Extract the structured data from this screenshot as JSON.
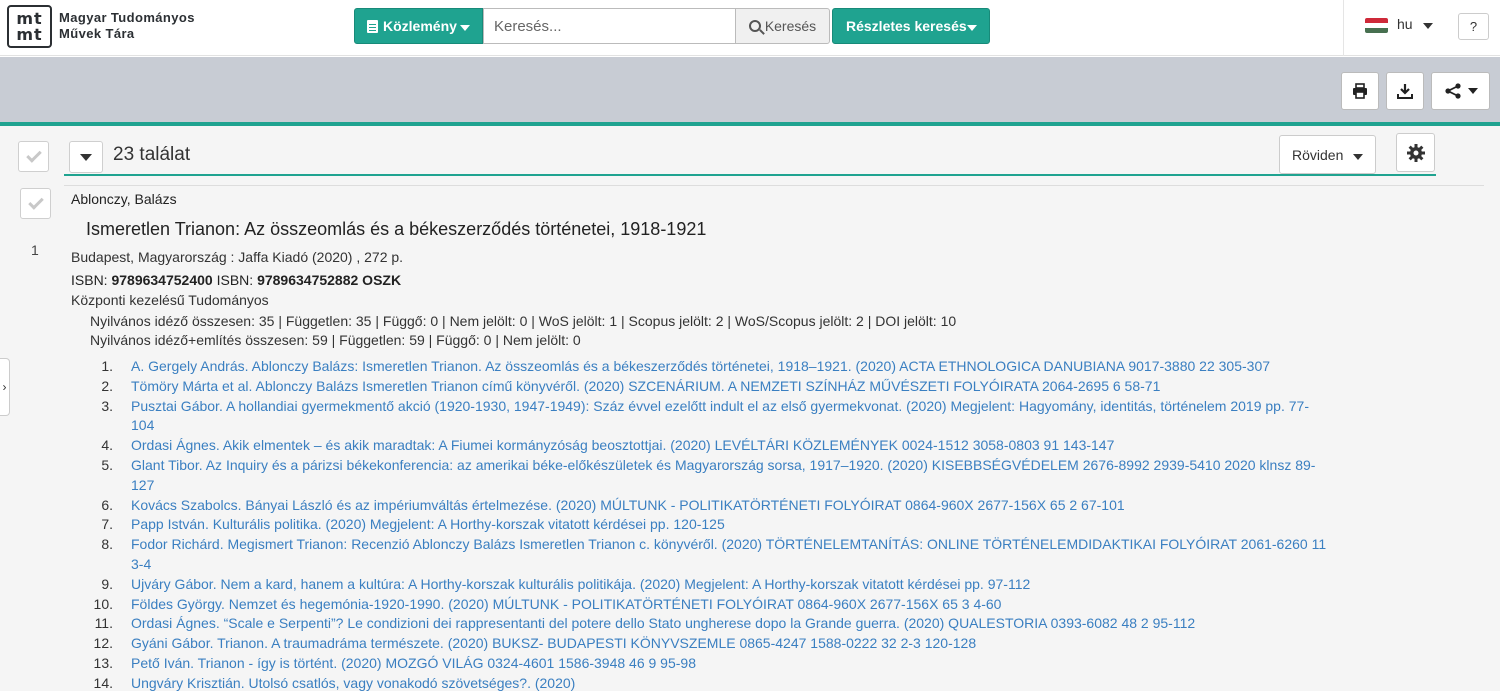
{
  "header": {
    "logo_line1": "mt",
    "logo_line2": "mt",
    "logo_text_line1": "Magyar Tudományos",
    "logo_text_line2": "Művek Tára",
    "publication_button": "Közlemény",
    "search_placeholder": "Keresés...",
    "search_button": "Keresés",
    "advanced_search_button": "Részletes keresés",
    "language": "hu",
    "help": "?"
  },
  "colors": {
    "accent": "#1fa390",
    "link": "#3a7fc1",
    "toolbar_bg": "#c8ccd4"
  },
  "toolbar": {
    "icons": [
      "print-icon",
      "download-icon",
      "share-icon"
    ]
  },
  "results": {
    "count_label": "23 találat",
    "sort_label": "Röviden"
  },
  "record": {
    "number": "1",
    "author": "Ablonczy, Balázs",
    "title": "Ismeretlen Trianon: Az összeomlás és a békeszerződés történetei, 1918-1921",
    "pub_info": "Budapest, Magyarország : Jaffa Kiadó (2020) , 272 p.",
    "isbn_label1": "ISBN: ",
    "isbn1": "9789634752400",
    "isbn_label2": " ISBN: ",
    "isbn2": "9789634752882",
    "oszk": " OSZK",
    "category": "Központi kezelésű Tudományos",
    "citation_stats": "Nyilvános idéző összesen: 35 | Független: 35 | Függő: 0 | Nem jelölt: 0 | WoS jelölt: 1 | Scopus jelölt: 2 | WoS/Scopus jelölt: 2 | DOI jelölt: 10",
    "mention_stats": "Nyilvános idéző+említés összesen: 59 | Független: 59 | Függő: 0 | Nem jelölt: 0"
  },
  "citations": [
    {
      "n": "1.",
      "text": "A. Gergely András. Ablonczy Balázs: Ismeretlen Trianon. Az összeomlás és a békeszerződés történetei, 1918–1921. (2020) ACTA ETHNOLOGICA DANUBIANA 9017-3880 22 305-307"
    },
    {
      "n": "2.",
      "text": "Tömöry Márta et al. Ablonczy Balázs Ismeretlen Trianon című könyvéről. (2020) SZCENÁRIUM. A NEMZETI SZÍNHÁZ MŰVÉSZETI FOLYÓIRATA 2064-2695 6 58-71"
    },
    {
      "n": "3.",
      "text": "Pusztai Gábor. A hollandiai gyermekmentő akció (1920-1930, 1947-1949): Száz évvel ezelőtt indult el az első gyermekvonat. (2020) Megjelent: Hagyomány, identitás, történelem 2019 pp. 77-104"
    },
    {
      "n": "4.",
      "text": "Ordasi Ágnes. Akik elmentek – és akik maradtak: A Fiumei kormányzóság beosztottjai. (2020) LEVÉLTÁRI KÖZLEMÉNYEK 0024-1512 3058-0803 91 143-147"
    },
    {
      "n": "5.",
      "text": "Glant Tibor. Az Inquiry és a párizsi békekonferencia: az amerikai béke-előkészületek és Magyarország sorsa, 1917–1920. (2020) KISEBBSÉGVÉDELEM 2676-8992 2939-5410 2020 klnsz 89-127"
    },
    {
      "n": "6.",
      "text": "Kovács Szabolcs. Bányai László és az impériumváltás értelmezése. (2020) MÚLTUNK - POLITIKATÖRTÉNETI FOLYÓIRAT 0864-960X 2677-156X 65 2 67-101"
    },
    {
      "n": "7.",
      "text": "Papp István. Kulturális politika. (2020) Megjelent: A Horthy-korszak vitatott kérdései pp. 120-125"
    },
    {
      "n": "8.",
      "text": "Fodor Richárd. Megismert Trianon: Recenzió Ablonczy Balázs Ismeretlen Trianon c. könyvéről. (2020) TÖRTÉNELEMTANÍTÁS: ONLINE TÖRTÉNELEMDIDAKTIKAI FOLYÓIRAT 2061-6260 11 3-4"
    },
    {
      "n": "9.",
      "text": "Ujváry Gábor. Nem a kard, hanem a kultúra: A Horthy-korszak kulturális politikája. (2020) Megjelent: A Horthy-korszak vitatott kérdései pp. 97-112"
    },
    {
      "n": "10.",
      "text": "Földes György. Nemzet és hegemónia-1920-1990. (2020) MÚLTUNK - POLITIKATÖRTÉNETI FOLYÓIRAT 0864-960X 2677-156X 65 3 4-60"
    },
    {
      "n": "11.",
      "text": "Ordasi Ágnes. “Scale e Serpenti”? Le condizioni dei rappresentanti del potere dello Stato ungherese dopo la Grande guerra. (2020) QUALESTORIA 0393-6082 48 2 95-112"
    },
    {
      "n": "12.",
      "text": "Gyáni Gábor. Trianon. A traumadráma természete. (2020) BUKSZ- BUDAPESTI KÖNYVSZEMLE 0865-4247 1588-0222 32 2-3 120-128"
    },
    {
      "n": "13.",
      "text": "Pető Iván. Trianon - így is történt. (2020) MOZGÓ VILÁG 0324-4601 1586-3948 46 9 95-98"
    },
    {
      "n": "14.",
      "text": "Ungváry Krisztián. Utolsó csatlós, vagy vonakodó szövetséges?. (2020)"
    }
  ]
}
